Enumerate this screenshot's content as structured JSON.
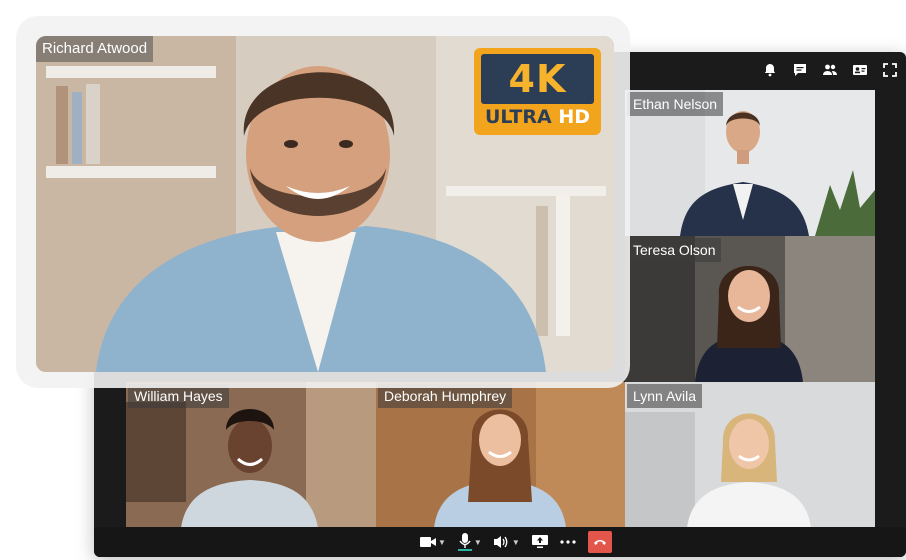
{
  "featured": {
    "name": "Richard Atwood"
  },
  "badge": {
    "big": "4K",
    "line1": "ULTRA",
    "line2": "HD"
  },
  "top_icons": [
    "bell-icon",
    "chat-icon",
    "participants-icon",
    "contact-card-icon",
    "fullscreen-icon"
  ],
  "participants": [
    {
      "name": "Ethan Nelson"
    },
    {
      "name": "Teresa Olson"
    },
    {
      "name": "William Hayes"
    },
    {
      "name": "Deborah Humphrey"
    },
    {
      "name": "Lynn Avila"
    }
  ],
  "toolbar": {
    "icons": [
      "camera-icon",
      "microphone-icon",
      "speaker-icon",
      "share-screen-icon",
      "more-icon",
      "hang-up-icon"
    ]
  },
  "colors": {
    "window_bg": "#1b1b1b",
    "badge_orange": "#f3a41d",
    "badge_navy": "#2c3e56",
    "hangup_red": "#e3564b",
    "mic_level": "#2bb3a6"
  }
}
